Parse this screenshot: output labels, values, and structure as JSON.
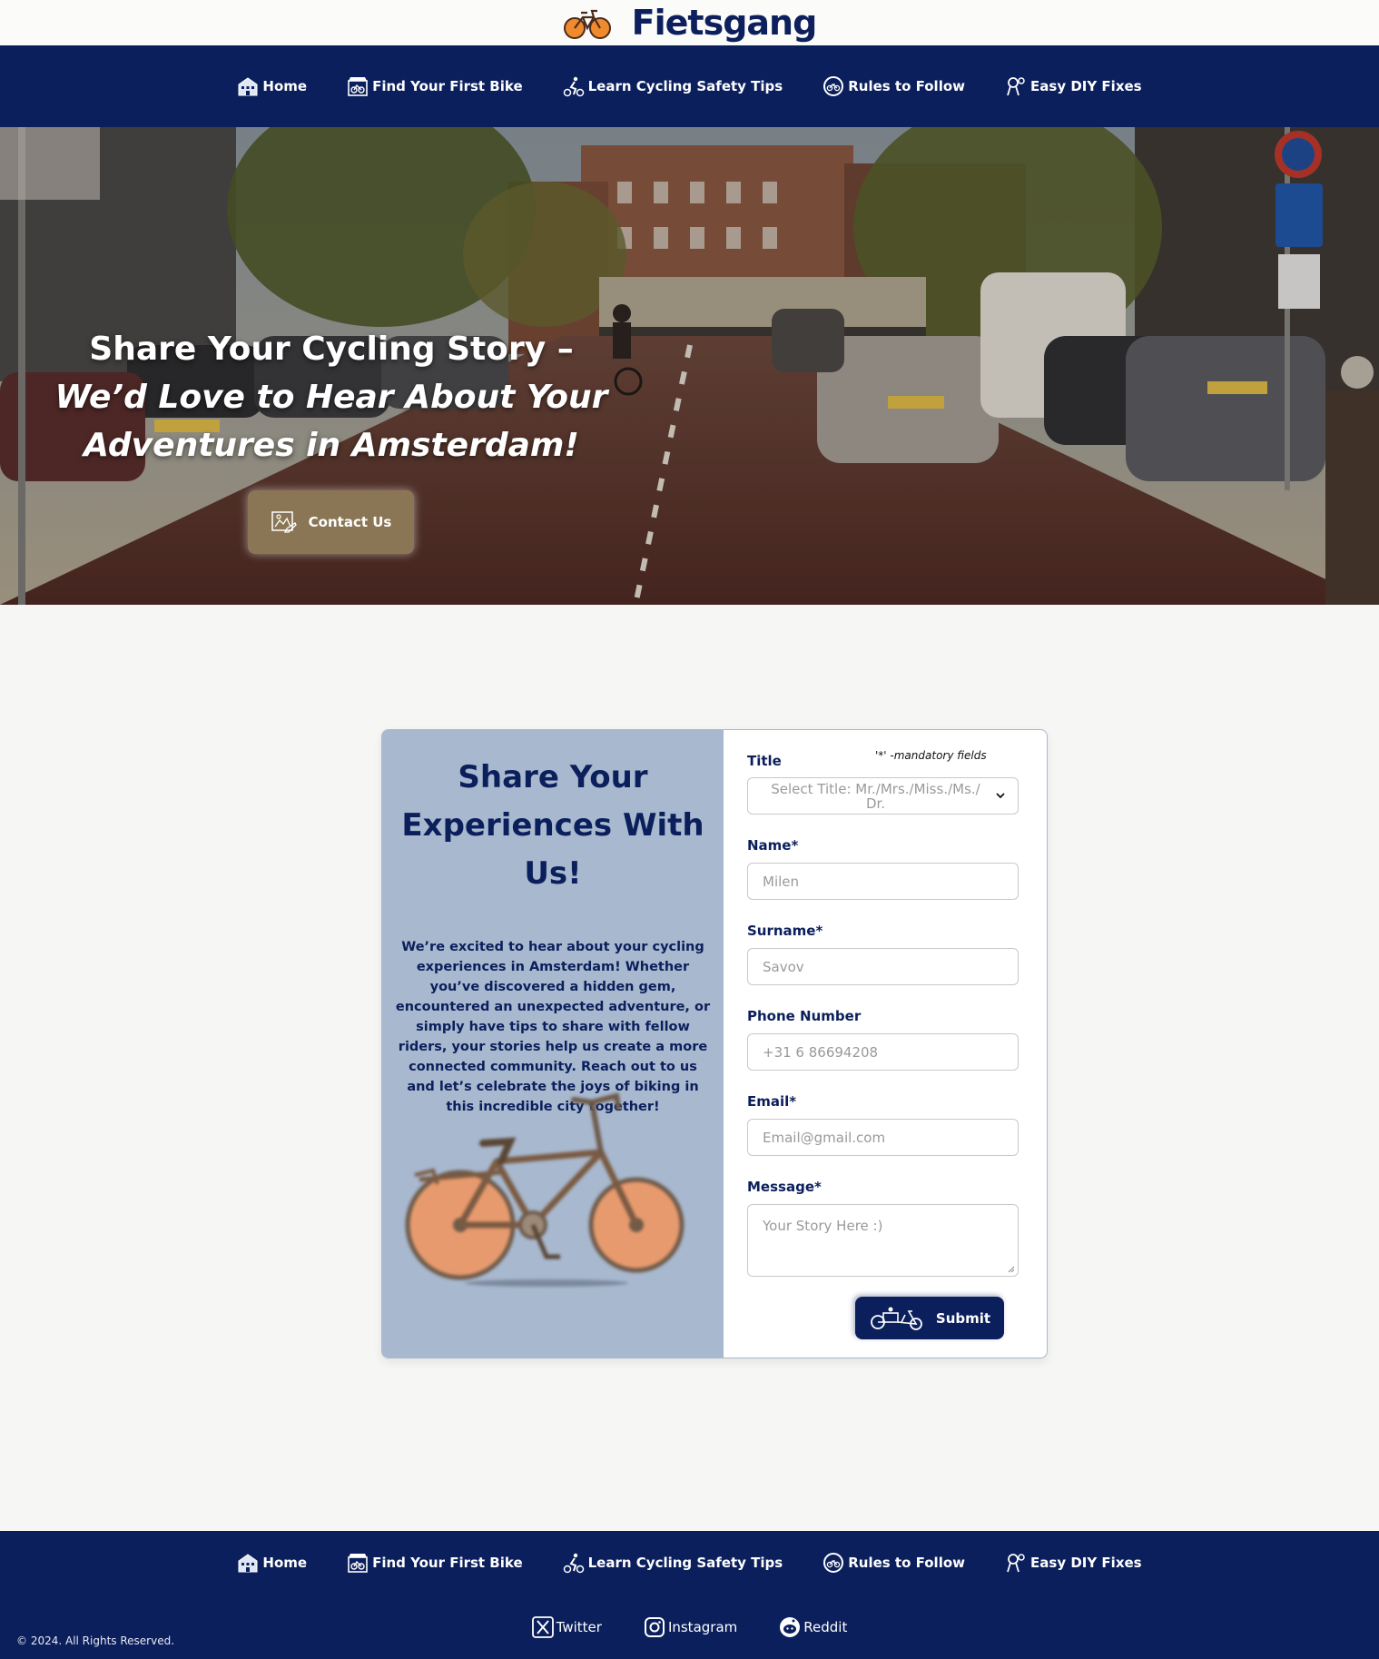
{
  "brand": {
    "name": "Fietsgang"
  },
  "nav": [
    {
      "label": "Home",
      "icon": "house-icon"
    },
    {
      "label": "Find Your First Bike",
      "icon": "bike-shop-icon"
    },
    {
      "label": "Learn Cycling Safety Tips",
      "icon": "cyclist-icon"
    },
    {
      "label": "Rules to Follow",
      "icon": "bike-sign-icon"
    },
    {
      "label": "Easy DIY Fixes",
      "icon": "wrench-icon"
    }
  ],
  "hero": {
    "title_plain": "Share Your Cycling Story – ",
    "title_italic": "We’d Love to Hear About Your Adventures in Amsterdam!",
    "button_label": "Contact Us"
  },
  "contact": {
    "heading": "Share Your Experiences With Us!",
    "text": "We’re excited to hear about your cycling experiences in Amsterdam! Whether you’ve discovered a hidden gem, encountered an unexpected adventure, or simply have tips to share with fellow riders, your stories help us create a more connected community. Reach out to us and let’s celebrate the joys of biking in this incredible city together!"
  },
  "form": {
    "mandatory_note": "'*' -mandatory fields",
    "title_label": "Title",
    "title_placeholder": "Select Title: Mr./Mrs./Miss./Ms./ Dr.",
    "name_label": "Name*",
    "name_placeholder": "Milen",
    "surname_label": "Surname*",
    "surname_placeholder": "Savov",
    "phone_label": "Phone Number",
    "phone_placeholder": "+31 6 86694208",
    "email_label": "Email*",
    "email_placeholder": "Email@gmail.com",
    "message_label": "Message*",
    "message_placeholder": "Your Story Here :)",
    "submit_label": "Submit"
  },
  "footer": {
    "copyright": "© 2024. All Rights Reserved.",
    "socials": [
      {
        "label": "Twitter",
        "icon": "x-icon"
      },
      {
        "label": "Instagram",
        "icon": "instagram-icon"
      },
      {
        "label": "Reddit",
        "icon": "reddit-icon"
      }
    ]
  },
  "colors": {
    "navy": "#0b1f5c",
    "card_blue": "#a8b8ce",
    "hero_button": "#8a7655",
    "background": "#f6f6f5"
  }
}
